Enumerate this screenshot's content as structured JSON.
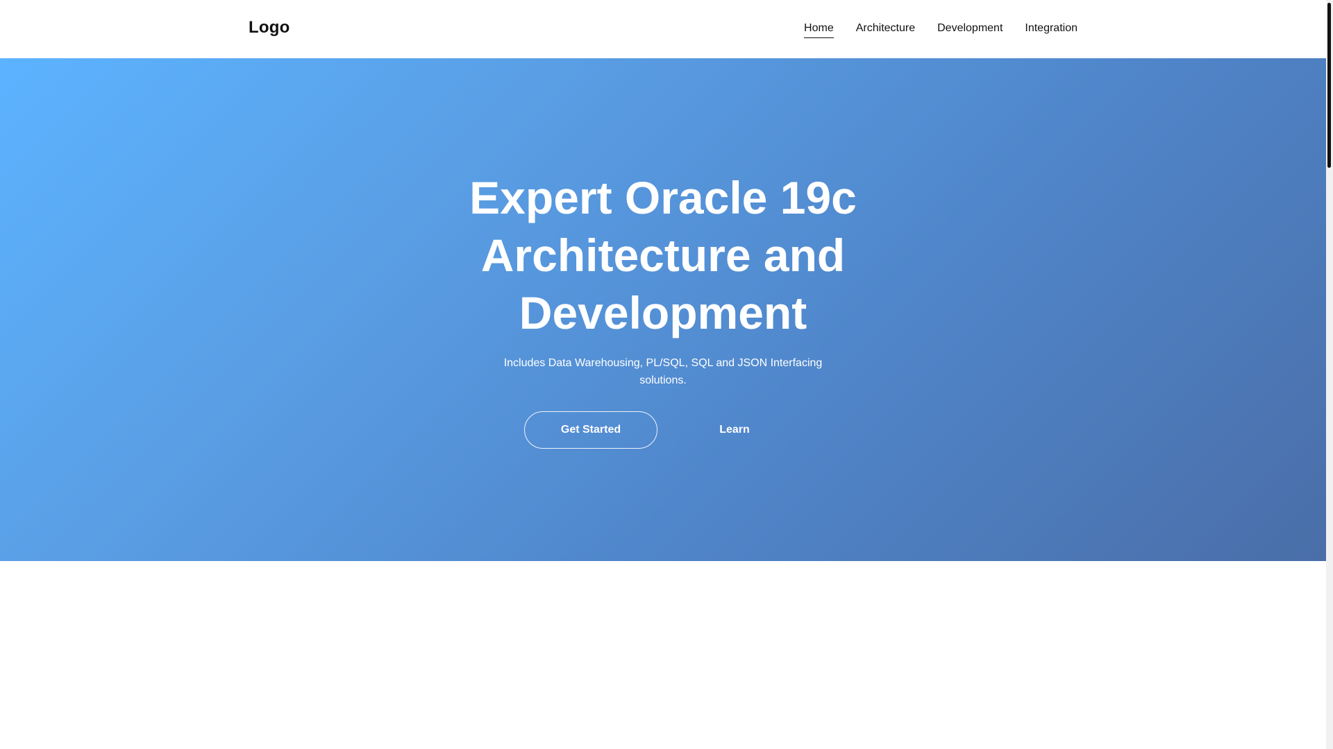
{
  "header": {
    "logo": "Logo",
    "nav": [
      {
        "label": "Home",
        "active": true
      },
      {
        "label": "Architecture",
        "active": false
      },
      {
        "label": "Development",
        "active": false
      },
      {
        "label": "Integration",
        "active": false
      }
    ]
  },
  "hero": {
    "title": "Expert Oracle 19c Architecture and Development",
    "subtitle": "Includes Data Warehousing, PL/SQL, SQL and JSON Interfacing solutions.",
    "primary_button": "Get Started",
    "secondary_button": "Learn"
  },
  "colors": {
    "hero_gradient_start": "#5cb3ff",
    "hero_gradient_end": "#4a6ea8",
    "text_dark": "#111111",
    "text_light": "#ffffff"
  }
}
